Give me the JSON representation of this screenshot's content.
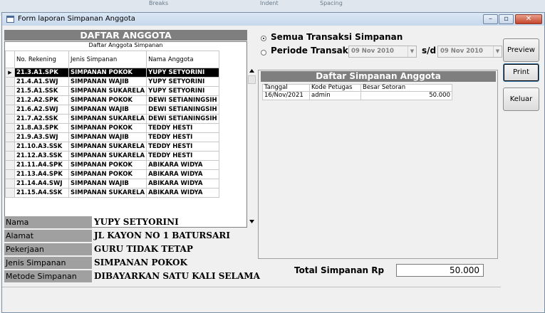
{
  "window": {
    "title": "Form laporan Simpanan Anggota"
  },
  "left_panel": {
    "header": "DAFTAR ANGGOTA",
    "grid_caption": "Daftar Anggota Simpanan",
    "columns": [
      "No. Rekening",
      "Jenis Simpanan",
      "Nama Anggota"
    ],
    "selected_row": 0,
    "rows": [
      [
        "21.3.A1.SPK",
        "SIMPANAN POKOK",
        "YUPY SETYORINI"
      ],
      [
        "21.4.A1.SWJ",
        "SIMPANAN WAJIB",
        "YUPY SETYORINI"
      ],
      [
        "21.5.A1.SSK",
        "SIMPANAN SUKARELA",
        "YUPY SETYORINI"
      ],
      [
        "21.2.A2.SPK",
        "SIMPANAN POKOK",
        "DEWI SETIANINGSIH"
      ],
      [
        "21.6.A2.SWJ",
        "SIMPANAN WAJIB",
        "DEWI SETIANINGSIH"
      ],
      [
        "21.7.A2.SSK",
        "SIMPANAN SUKARELA",
        "DEWI SETIANINGSIH"
      ],
      [
        "21.8.A3.SPK",
        "SIMPANAN POKOK",
        "TEDDY HESTI"
      ],
      [
        "21.9.A3.SWJ",
        "SIMPANAN WAJIB",
        "TEDDY HESTI"
      ],
      [
        "21.10.A3.SSK",
        "SIMPANAN SUKARELA",
        "TEDDY HESTI"
      ],
      [
        "21.12.A3.SSK",
        "SIMPANAN SUKARELA",
        "TEDDY HESTI"
      ],
      [
        "21.11.A4.SPK",
        "SIMPANAN POKOK",
        "ABIKARA WIDYA"
      ],
      [
        "21.13.A4.SPK",
        "SIMPANAN POKOK",
        "ABIKARA WIDYA"
      ],
      [
        "21.14.A4.SWJ",
        "SIMPANAN WAJIB",
        "ABIKARA WIDYA"
      ],
      [
        "21.15.A4.SSK",
        "SIMPANAN SUKARELA",
        "ABIKARA WIDYA"
      ]
    ],
    "details": [
      {
        "label": "Nama",
        "value": "YUPY SETYORINI"
      },
      {
        "label": "Alamat",
        "value": "JL KAYON NO 1 BATURSARI"
      },
      {
        "label": "Pekerjaan",
        "value": "GURU TIDAK TETAP"
      },
      {
        "label": "Jenis Simpanan",
        "value": "SIMPANAN POKOK"
      },
      {
        "label": "Metode Simpanan",
        "value": "DIBAYARKAN SATU KALI SELAMA"
      }
    ]
  },
  "filter": {
    "option_all": "Semua Transaksi Simpanan",
    "option_period": "Periode Transaksi",
    "selected": "all",
    "date_from": "09 Nov 2010",
    "separator": "s/d",
    "date_to": "09 Nov 2010"
  },
  "simpanan_panel": {
    "header": "Daftar Simpanan Anggota",
    "columns": [
      "Tanggal",
      "Kode Petugas",
      "Besar Setoran"
    ],
    "rows": [
      [
        "16/Nov/2021",
        "admin",
        "50.000"
      ]
    ]
  },
  "buttons": {
    "preview": "Preview",
    "print": "Print",
    "keluar": "Keluar"
  },
  "total": {
    "label": "Total Simpanan Rp",
    "value": "50.000"
  },
  "background_app": {
    "tabs": [
      "Breaks",
      "Indent",
      "Spacing"
    ]
  }
}
